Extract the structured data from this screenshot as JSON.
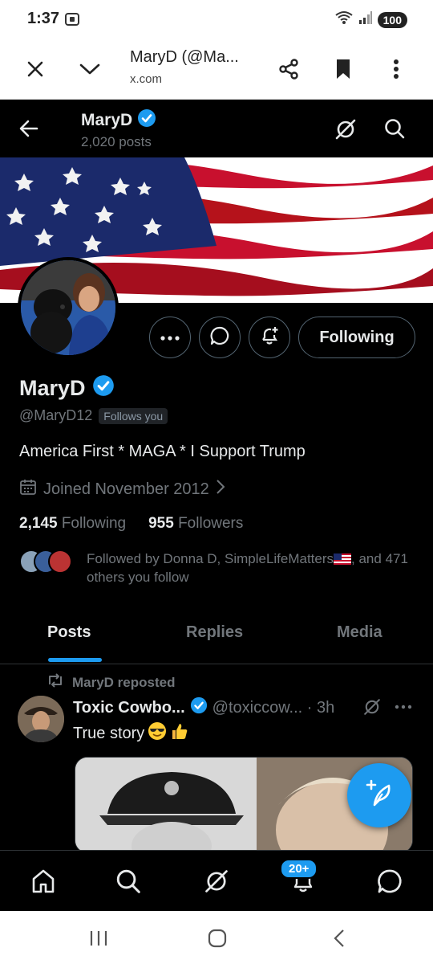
{
  "status_bar": {
    "time": "1:37",
    "battery": "100",
    "wifi_label": "5"
  },
  "browser": {
    "title": "MaryD (@Ma...",
    "url": "x.com",
    "close_icon": "close-icon",
    "menu_icon": "chevron-down-icon",
    "share_icon": "share-icon",
    "bookmark_icon": "bookmark-icon",
    "more_icon": "more-vertical-icon"
  },
  "header": {
    "name": "MaryD",
    "posts": "2,020 posts"
  },
  "profile": {
    "name": "MaryD",
    "handle": "@MaryD12",
    "follows_you": "Follows you",
    "bio": "America First * MAGA * I Support Trump",
    "joined": "Joined November 2012",
    "following_count": "2,145",
    "following_label": "Following",
    "followers_count": "955",
    "followers_label": "Followers",
    "followed_by_prefix": "Followed by Donna D, SimpleLifeMatters",
    "followed_by_suffix": ", and 471 others you follow",
    "following_button": "Following"
  },
  "tabs": [
    {
      "label": "Posts",
      "active": true
    },
    {
      "label": "Replies",
      "active": false
    },
    {
      "label": "Media",
      "active": false
    }
  ],
  "post": {
    "repost_label": "MaryD reposted",
    "author": "Toxic Cowbo...",
    "handle_time": "@toxiccow... · 3h",
    "text": "True story"
  },
  "nav": {
    "notifications_badge": "20+"
  },
  "colors": {
    "accent": "#1d9bf0",
    "muted": "#71767b",
    "text": "#e7e9ea",
    "border": "#2f3336"
  }
}
